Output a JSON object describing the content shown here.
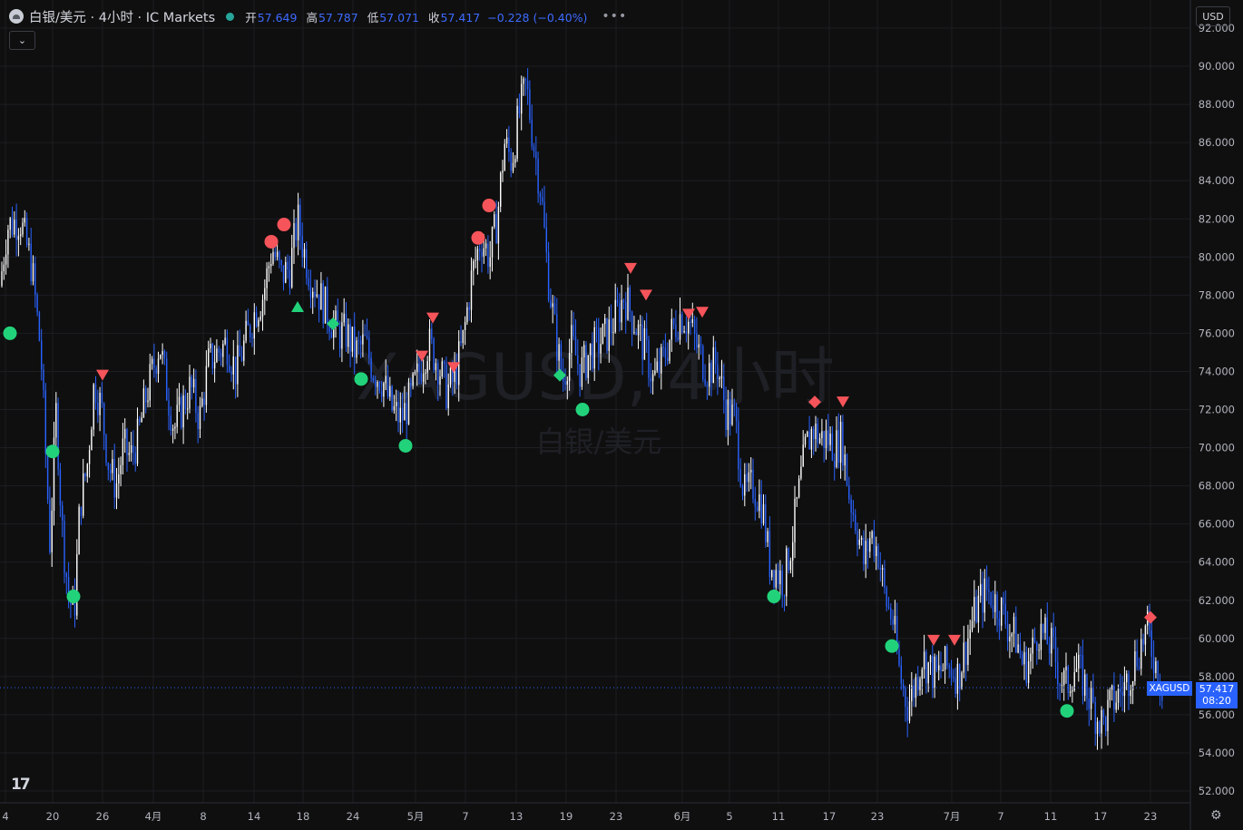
{
  "header": {
    "symbol_title": "白银/美元 · 4小时 · IC Markets",
    "open_label": "开",
    "open": "57.649",
    "high_label": "高",
    "high": "57.787",
    "low_label": "低",
    "low": "57.071",
    "close_label": "收",
    "close": "57.417",
    "change": "−0.228 (−0.40%)",
    "more": "•••",
    "collapse": "⌄"
  },
  "currency": "USD",
  "watermark": {
    "line1": "XAGUSD, 4小时",
    "line2": "白银/美元"
  },
  "price_tag": {
    "symbol": "XAGUSD",
    "price": "57.417",
    "countdown": "08:20"
  },
  "colors": {
    "background": "#0f0f0f",
    "candle": "#ffffff",
    "candle_down": "#2962ff",
    "buy": "#22d27a",
    "sell": "#f5545a",
    "accent": "#2962ff"
  },
  "icons": [
    "tradingview-logo-icon",
    "settings-gear-icon"
  ],
  "chart_data": {
    "type": "line",
    "xlabel": "",
    "ylabel": "",
    "y_range": [
      51.2,
      92.5
    ],
    "y_ticks": [
      "52.000",
      "54.000",
      "56.000",
      "58.000",
      "60.000",
      "62.000",
      "64.000",
      "66.000",
      "68.000",
      "70.000",
      "72.000",
      "74.000",
      "76.000",
      "78.000",
      "80.000",
      "82.000",
      "84.000",
      "86.000",
      "88.000",
      "90.000",
      "92.000"
    ],
    "x_tick_labels": [
      "4",
      "20",
      "26",
      "4月",
      "8",
      "14",
      "18",
      "24",
      "5月",
      "7",
      "13",
      "19",
      "23",
      "6月",
      "5",
      "11",
      "17",
      "23",
      "7月",
      "7",
      "11",
      "17",
      "23"
    ],
    "series": [
      {
        "values": [
          [
            0,
            78.5
          ],
          [
            8,
            81.6
          ],
          [
            22,
            82.0
          ],
          [
            35,
            79.5
          ],
          [
            45,
            75.0
          ],
          [
            55,
            65.0
          ],
          [
            62,
            72.0
          ],
          [
            68,
            66.0
          ],
          [
            76,
            62.0
          ],
          [
            82,
            61.5
          ],
          [
            88,
            67.0
          ],
          [
            96,
            69.0
          ],
          [
            104,
            73.5
          ],
          [
            112,
            72.0
          ],
          [
            120,
            69.0
          ],
          [
            128,
            68.0
          ],
          [
            136,
            70.0
          ],
          [
            144,
            69.5
          ],
          [
            152,
            70.5
          ],
          [
            160,
            72.5
          ],
          [
            168,
            74.0
          ],
          [
            176,
            75.5
          ],
          [
            184,
            73.0
          ],
          [
            192,
            71.0
          ],
          [
            200,
            72.0
          ],
          [
            210,
            73.2
          ],
          [
            220,
            71.5
          ],
          [
            230,
            74.5
          ],
          [
            240,
            75.0
          ],
          [
            250,
            75.5
          ],
          [
            260,
            74.0
          ],
          [
            270,
            75.5
          ],
          [
            280,
            77.0
          ],
          [
            290,
            78.0
          ],
          [
            300,
            80.5
          ],
          [
            310,
            79.0
          ],
          [
            320,
            79.5
          ],
          [
            328,
            82.0
          ],
          [
            334,
            80.5
          ],
          [
            342,
            79.0
          ],
          [
            352,
            78.0
          ],
          [
            362,
            77.0
          ],
          [
            372,
            76.0
          ],
          [
            382,
            76.0
          ],
          [
            392,
            75.0
          ],
          [
            402,
            75.5
          ],
          [
            412,
            74.0
          ],
          [
            422,
            73.5
          ],
          [
            432,
            72.0
          ],
          [
            442,
            71.5
          ],
          [
            452,
            72.5
          ],
          [
            462,
            74.0
          ],
          [
            472,
            75.5
          ],
          [
            482,
            74.5
          ],
          [
            492,
            73.0
          ],
          [
            500,
            73.5
          ],
          [
            510,
            75.5
          ],
          [
            520,
            79.0
          ],
          [
            530,
            81.0
          ],
          [
            540,
            80.0
          ],
          [
            548,
            82.0
          ],
          [
            556,
            86.0
          ],
          [
            564,
            85.0
          ],
          [
            572,
            87.5
          ],
          [
            580,
            89.0
          ],
          [
            588,
            86.0
          ],
          [
            596,
            83.5
          ],
          [
            604,
            79.0
          ],
          [
            612,
            76.0
          ],
          [
            620,
            73.5
          ],
          [
            630,
            75.5
          ],
          [
            640,
            74.0
          ],
          [
            650,
            75.0
          ],
          [
            660,
            75.5
          ],
          [
            670,
            76.0
          ],
          [
            680,
            77.0
          ],
          [
            688,
            78.0
          ],
          [
            696,
            77.0
          ],
          [
            704,
            76.0
          ],
          [
            712,
            75.0
          ],
          [
            720,
            73.5
          ],
          [
            730,
            74.5
          ],
          [
            740,
            76.0
          ],
          [
            750,
            77.0
          ],
          [
            760,
            76.5
          ],
          [
            770,
            75.0
          ],
          [
            780,
            74.0
          ],
          [
            790,
            74.5
          ],
          [
            800,
            72.0
          ],
          [
            810,
            71.5
          ],
          [
            820,
            67.5
          ],
          [
            830,
            68.0
          ],
          [
            840,
            67.0
          ],
          [
            848,
            64.0
          ],
          [
            856,
            63.5
          ],
          [
            864,
            63.0
          ],
          [
            872,
            65.0
          ],
          [
            880,
            67.5
          ],
          [
            888,
            70.0
          ],
          [
            896,
            71.0
          ],
          [
            904,
            70.5
          ],
          [
            912,
            70.5
          ],
          [
            920,
            70.0
          ],
          [
            928,
            70.5
          ],
          [
            936,
            67.5
          ],
          [
            944,
            66.0
          ],
          [
            952,
            64.0
          ],
          [
            960,
            65.5
          ],
          [
            968,
            64.5
          ],
          [
            976,
            62.0
          ],
          [
            984,
            61.0
          ],
          [
            992,
            58.0
          ],
          [
            1000,
            56.5
          ],
          [
            1008,
            57.5
          ],
          [
            1016,
            59.0
          ],
          [
            1024,
            58.5
          ],
          [
            1032,
            58.0
          ],
          [
            1040,
            58.5
          ],
          [
            1048,
            58.5
          ],
          [
            1056,
            58.0
          ],
          [
            1064,
            59.5
          ],
          [
            1072,
            61.0
          ],
          [
            1080,
            62.0
          ],
          [
            1088,
            62.5
          ],
          [
            1096,
            62.0
          ],
          [
            1104,
            61.5
          ],
          [
            1112,
            60.5
          ],
          [
            1120,
            60.0
          ],
          [
            1128,
            58.5
          ],
          [
            1136,
            59.0
          ],
          [
            1144,
            60.5
          ],
          [
            1152,
            60.0
          ],
          [
            1160,
            59.5
          ],
          [
            1168,
            58.0
          ],
          [
            1176,
            57.5
          ],
          [
            1184,
            58.5
          ],
          [
            1192,
            58.0
          ],
          [
            1200,
            57.0
          ],
          [
            1208,
            56.0
          ],
          [
            1216,
            55.5
          ],
          [
            1224,
            56.5
          ],
          [
            1232,
            57.0
          ],
          [
            1240,
            57.5
          ],
          [
            1248,
            58.5
          ],
          [
            1256,
            59.5
          ],
          [
            1264,
            60.5
          ],
          [
            1272,
            59.0
          ],
          [
            1280,
            57.5
          ]
        ]
      }
    ],
    "markers": [
      {
        "kind": "circle",
        "color": "buy",
        "x": 11,
        "y": 76.0
      },
      {
        "kind": "circle",
        "color": "buy",
        "x": 58,
        "y": 69.8
      },
      {
        "kind": "circle",
        "color": "buy",
        "x": 81,
        "y": 62.2
      },
      {
        "kind": "tri-down",
        "color": "sell",
        "x": 113,
        "y": 73.8
      },
      {
        "kind": "circle",
        "color": "sell",
        "x": 299,
        "y": 80.8
      },
      {
        "kind": "circle",
        "color": "sell",
        "x": 313,
        "y": 81.7
      },
      {
        "kind": "tri-up",
        "color": "buy",
        "x": 328,
        "y": 77.4
      },
      {
        "kind": "diamond",
        "color": "buy",
        "x": 367,
        "y": 76.5
      },
      {
        "kind": "circle",
        "color": "buy",
        "x": 398,
        "y": 73.6
      },
      {
        "kind": "circle",
        "color": "buy",
        "x": 447,
        "y": 70.1
      },
      {
        "kind": "tri-down",
        "color": "sell",
        "x": 465,
        "y": 74.8
      },
      {
        "kind": "tri-down",
        "color": "sell",
        "x": 477,
        "y": 76.8
      },
      {
        "kind": "tri-down",
        "color": "sell",
        "x": 500,
        "y": 74.2
      },
      {
        "kind": "circle",
        "color": "sell",
        "x": 527,
        "y": 81.0
      },
      {
        "kind": "circle",
        "color": "sell",
        "x": 539,
        "y": 82.7
      },
      {
        "kind": "diamond",
        "color": "buy",
        "x": 617,
        "y": 73.8
      },
      {
        "kind": "circle",
        "color": "buy",
        "x": 642,
        "y": 72.0
      },
      {
        "kind": "tri-down",
        "color": "sell",
        "x": 695,
        "y": 79.4
      },
      {
        "kind": "tri-down",
        "color": "sell",
        "x": 712,
        "y": 78.0
      },
      {
        "kind": "tri-down",
        "color": "sell",
        "x": 759,
        "y": 77.0
      },
      {
        "kind": "tri-down",
        "color": "sell",
        "x": 774,
        "y": 77.1
      },
      {
        "kind": "diamond",
        "color": "sell",
        "x": 898,
        "y": 72.4
      },
      {
        "kind": "tri-down",
        "color": "sell",
        "x": 929,
        "y": 72.4
      },
      {
        "kind": "circle",
        "color": "buy",
        "x": 853,
        "y": 62.2
      },
      {
        "kind": "circle",
        "color": "buy",
        "x": 983,
        "y": 59.6
      },
      {
        "kind": "tri-down",
        "color": "sell",
        "x": 1029,
        "y": 59.9
      },
      {
        "kind": "tri-down",
        "color": "sell",
        "x": 1052,
        "y": 59.9
      },
      {
        "kind": "circle",
        "color": "buy",
        "x": 1176,
        "y": 56.2
      },
      {
        "kind": "diamond",
        "color": "sell",
        "x": 1268,
        "y": 61.1
      }
    ]
  }
}
